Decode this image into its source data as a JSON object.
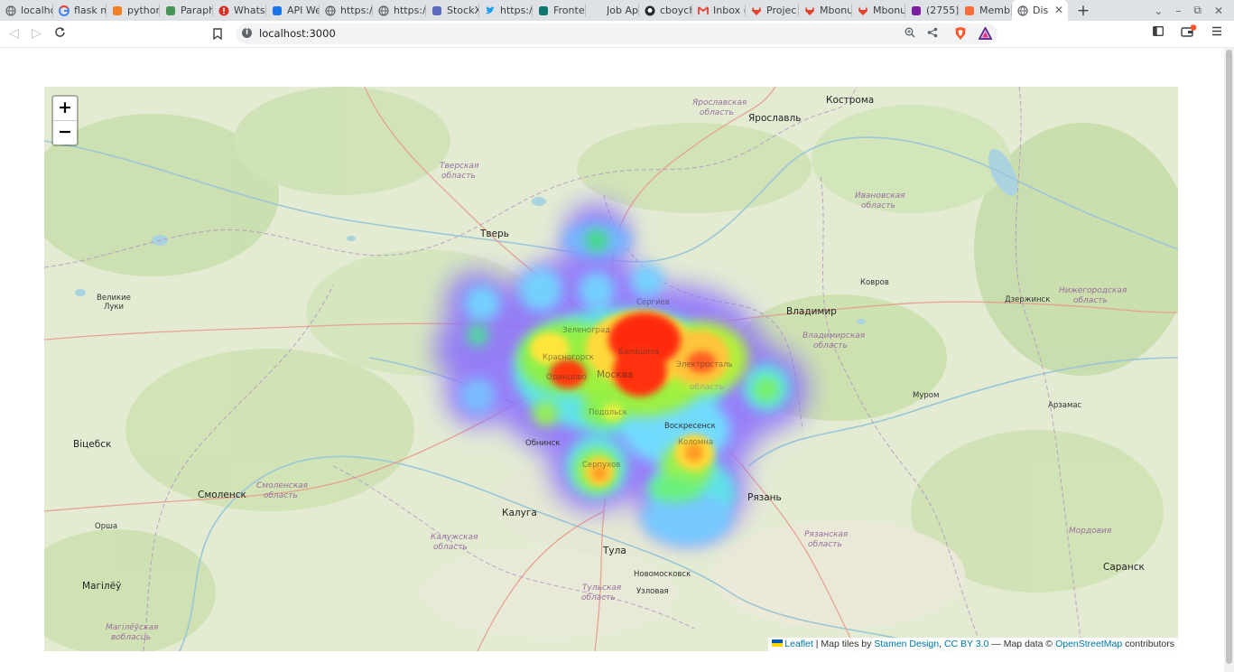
{
  "browser": {
    "tabs": [
      {
        "title": "localhost",
        "icon": "globe-icon",
        "color": "#5f6368"
      },
      {
        "title": "flask ne",
        "icon": "google-icon",
        "color": "#4285f4"
      },
      {
        "title": "python",
        "icon": "stackoverflow-icon",
        "color": "#f48024"
      },
      {
        "title": "Paraph",
        "icon": "quillbot-icon",
        "color": "#499557"
      },
      {
        "title": "Whats",
        "icon": "alert-icon",
        "color": "#d93025"
      },
      {
        "title": "API We",
        "icon": "shield-icon",
        "color": "#1a73e8"
      },
      {
        "title": "https://",
        "icon": "globe-icon",
        "color": "#5f6368"
      },
      {
        "title": "https://",
        "icon": "globe-icon",
        "color": "#5f6368"
      },
      {
        "title": "StockX",
        "icon": "doc-icon",
        "color": "#5c6bc0"
      },
      {
        "title": "https://",
        "icon": "twitter-icon",
        "color": "#1da1f2"
      },
      {
        "title": "Fronte",
        "icon": "frontend-icon",
        "color": "#0f766e"
      },
      {
        "title": "Job Ap",
        "icon": "blank-icon",
        "color": "#ffffff"
      },
      {
        "title": "cboych",
        "icon": "github-icon",
        "color": "#24292e"
      },
      {
        "title": "Inbox (",
        "icon": "gmail-icon",
        "color": "#ea4335"
      },
      {
        "title": "Projec",
        "icon": "gitlab-icon",
        "color": "#e24329"
      },
      {
        "title": "Mbonu",
        "icon": "gitlab-icon",
        "color": "#e24329"
      },
      {
        "title": "Mbonu",
        "icon": "gitlab-icon",
        "color": "#e24329"
      },
      {
        "title": "(2755)",
        "icon": "mail-icon",
        "color": "#7b1fa2"
      },
      {
        "title": "Memb",
        "icon": "postman-icon",
        "color": "#ff6c37"
      },
      {
        "title": "Dis",
        "icon": "globe-icon",
        "color": "#5f6368",
        "active": true
      }
    ],
    "new_tab": "+",
    "address": "localhost:3000"
  },
  "map": {
    "zoom_in": "+",
    "zoom_out": "−",
    "attribution": {
      "leaflet": "Leaflet",
      "sep1": " | Map tiles by ",
      "stamen": "Stamen Design",
      "comma": ", ",
      "license": "CC BY 3.0",
      "mid": " — Map data © ",
      "osm": "OpenStreetMap",
      "end": " contributors"
    },
    "labels": {
      "kostroma": "Кострома",
      "yaroslavl_obl_1": "Ярославская",
      "yaroslavl_obl_2": "область",
      "yaroslavl": "Ярославль",
      "tver_obl_1": "Тверская",
      "tver_obl_2": "область",
      "ivanovo_obl_1": "Ивановская",
      "ivanovo_obl_2": "область",
      "tver": "Тверь",
      "kovrov": "Ковров",
      "dzerzhinsk": "Дзержинск",
      "nn_obl_1": "Нижегородская",
      "nn_obl_2": "область",
      "v_luki_1": "Великие",
      "v_luki_2": "Луки",
      "vladimir": "Владимир",
      "vladimir_obl_1": "Владимирская",
      "vladimir_obl_2": "область",
      "murom": "Муром",
      "arzamas": "Арзамас",
      "vitebsk": "Віцебск",
      "obninsk": "Обнинск",
      "voskresensk": "Воскресенск",
      "smolensk": "Смоленск",
      "smolensk_obl_1": "Смоленская",
      "smolensk_obl_2": "область",
      "ryazan": "Рязань",
      "orsha": "Орша",
      "kaluga": "Калуга",
      "kaluga_obl_1": "Калужская",
      "kaluga_obl_2": "область",
      "tula": "Тула",
      "ryazan_obl_1": "Рязанская",
      "ryazan_obl_2": "область",
      "mordovia": "Мордовия",
      "novomoskovsk": "Новомосковск",
      "saransk": "Саранск",
      "uzlovaya": "Узловая",
      "tula_obl_1": "Тульская",
      "tula_obl_2": "область",
      "mogilev": "Магілёў",
      "mogilev_obl_1": "Магілёўская",
      "mogilev_obl_2": "вобласць",
      "moskva": "Москва",
      "sergiev": "Сергиев",
      "zelenograd": "Зеленоград",
      "krasnogorsk": "Красногорск",
      "odintsovo": "Одинцово",
      "podolsk": "Подольск",
      "serpukhov": "Серпухов",
      "kolomna": "Коломна",
      "balashikha": "Балашиха",
      "elektrostal": "Электросталь",
      "moscow_obl": "область"
    }
  }
}
